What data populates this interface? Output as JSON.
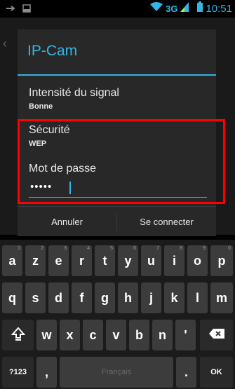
{
  "statusbar": {
    "network": "3G",
    "time": "10:51",
    "icons": [
      "usb-icon",
      "screenshot-icon",
      "wifi-icon",
      "signal-icon",
      "battery-icon"
    ]
  },
  "dialog": {
    "title": "IP-Cam",
    "signal": {
      "label": "Intensité du signal",
      "value": "Bonne"
    },
    "security": {
      "label": "Sécurité",
      "value": "WEP"
    },
    "password": {
      "label": "Mot de passe",
      "masked": "•••••"
    },
    "buttons": {
      "cancel": "Annuler",
      "connect": "Se connecter"
    }
  },
  "keyboard": {
    "row1": [
      {
        "k": "a",
        "n": "1"
      },
      {
        "k": "z",
        "n": "2"
      },
      {
        "k": "e",
        "n": "3"
      },
      {
        "k": "r",
        "n": "4"
      },
      {
        "k": "t",
        "n": "5"
      },
      {
        "k": "y",
        "n": "6"
      },
      {
        "k": "u",
        "n": "7"
      },
      {
        "k": "i",
        "n": "8"
      },
      {
        "k": "o",
        "n": "9"
      },
      {
        "k": "p",
        "n": "0"
      }
    ],
    "row2": [
      "q",
      "s",
      "d",
      "f",
      "g",
      "h",
      "j",
      "k",
      "l",
      "m"
    ],
    "row3": [
      "w",
      "x",
      "c",
      "v",
      "b",
      "n",
      "'"
    ],
    "row4": {
      "symbols": "?123",
      "comma": ",",
      "space": "Français",
      "period": ".",
      "ok": "OK"
    }
  },
  "colors": {
    "accent": "#33b5e5",
    "highlight": "#ff0000",
    "dialog_bg": "#282828",
    "key_bg": "#3c3c3c"
  }
}
